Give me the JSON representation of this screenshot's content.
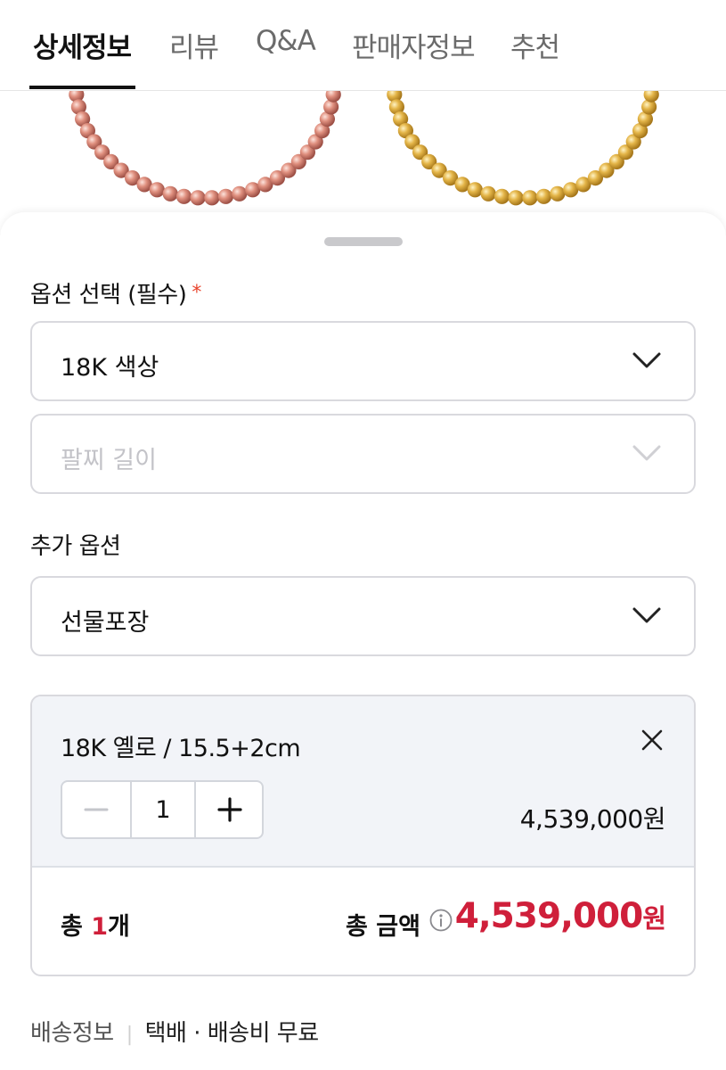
{
  "tabs": [
    {
      "label": "상세정보",
      "active": true
    },
    {
      "label": "리뷰",
      "active": false
    },
    {
      "label": "Q&A",
      "active": false
    },
    {
      "label": "판매자정보",
      "active": false
    },
    {
      "label": "추천",
      "active": false
    }
  ],
  "product_image": {
    "bracelets": [
      {
        "color_name": "rose-gold",
        "color": "#d9867a"
      },
      {
        "color_name": "yellow-gold",
        "color": "#e0b043"
      }
    ]
  },
  "options": {
    "required_label": "옵션 선택 (필수)",
    "required_mark": "*",
    "color_select": {
      "value": "18K 색상",
      "icon": "chevron-down-icon"
    },
    "length_select": {
      "placeholder": "팔찌 길이",
      "disabled": true,
      "icon": "chevron-down-icon"
    },
    "extra_label": "추가 옵션",
    "extra_select": {
      "value": "선물포장",
      "icon": "chevron-down-icon"
    }
  },
  "selected_item": {
    "name": "18K 옐로 / 15.5+2cm",
    "quantity": "1",
    "price": "4,539,000원",
    "decrease_icon": "minus-icon",
    "increase_icon": "plus-icon",
    "remove_icon": "close-icon"
  },
  "summary": {
    "count_prefix": "총 ",
    "count_number": "1",
    "count_suffix": "개",
    "amount_label": "총 금액",
    "amount_number": "4,539,000",
    "amount_unit": "원",
    "info_icon": "info-icon"
  },
  "shipping": {
    "label": "배송정보",
    "separator": "|",
    "value": "택배 · 배송비 무료"
  },
  "colors": {
    "accent_red": "#cf1f3a",
    "required_star": "#e8442d",
    "item_bg": "#f2f4f8"
  }
}
